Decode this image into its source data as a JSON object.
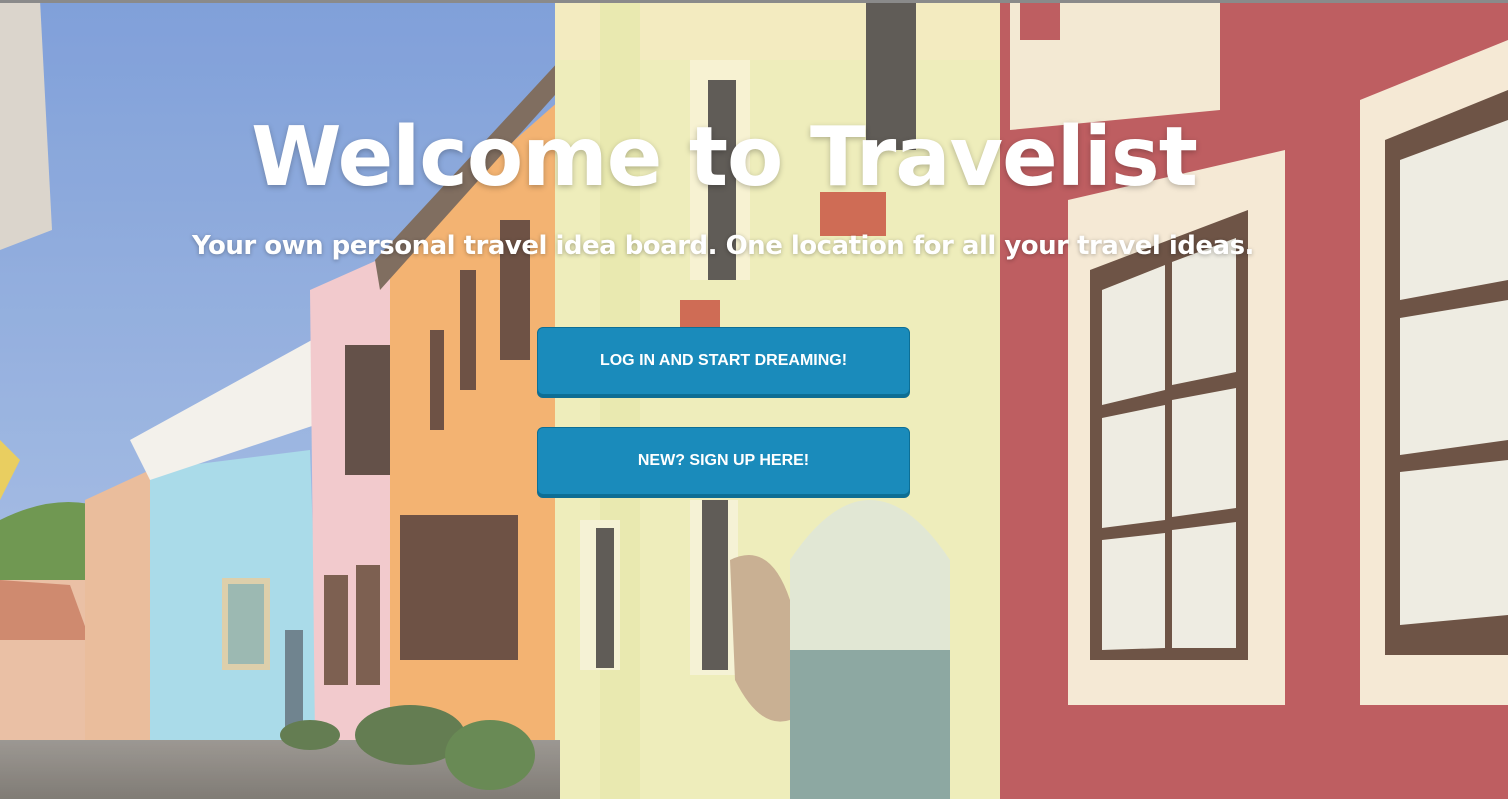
{
  "hero": {
    "title": "Welcome to Travelist",
    "subtitle": "Your own personal travel idea board. One location for all your travel ideas."
  },
  "actions": {
    "login_label": "LOG IN AND START DREAMING!",
    "signup_label": "NEW? SIGN UP HERE!"
  },
  "colors": {
    "button": "#1a8bbb",
    "button_shadow": "#0e6d93",
    "text": "#ffffff"
  }
}
